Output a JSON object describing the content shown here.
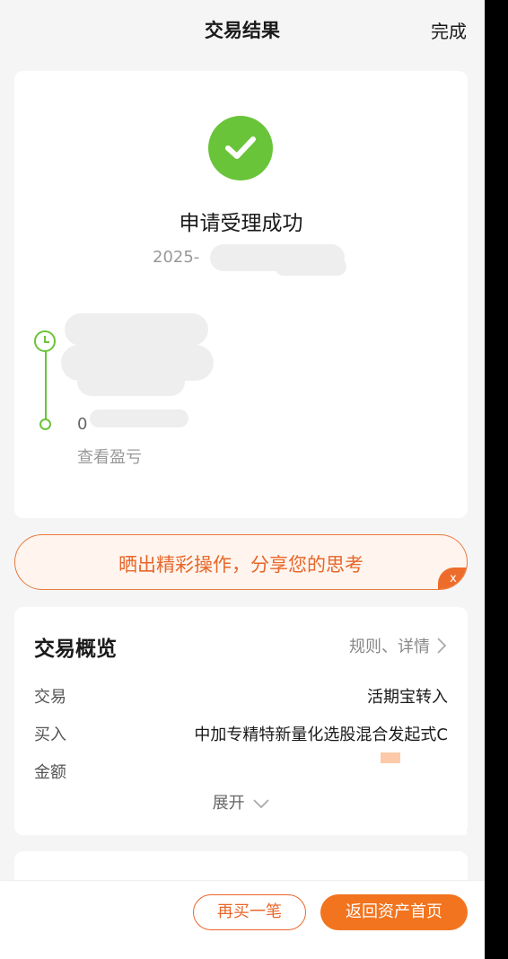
{
  "header": {
    "title": "交易结果",
    "done_label": "完成"
  },
  "result": {
    "status_title": "申请受理成功",
    "time_visible": "2025-",
    "time_tail": "1",
    "step_two_visible": "0",
    "profit_link": "查看盈亏",
    "status_color": "#6ac43a"
  },
  "share_banner": {
    "text": "晒出精彩操作，分享您的思考",
    "close_label": "x"
  },
  "overview": {
    "title": "交易概览",
    "rules_label": "规则、详情",
    "rows": [
      {
        "label": "交易",
        "value": "活期宝转入"
      },
      {
        "label": "买入",
        "value": "中加专精特新量化选股混合发起式C"
      },
      {
        "label": "金额",
        "value": ""
      }
    ],
    "expand_label": "展开"
  },
  "bottom_bar": {
    "again_label": "再买一笔",
    "home_label": "返回资产首页"
  },
  "colors": {
    "accent": "#f2741f",
    "success": "#6ac43a"
  }
}
